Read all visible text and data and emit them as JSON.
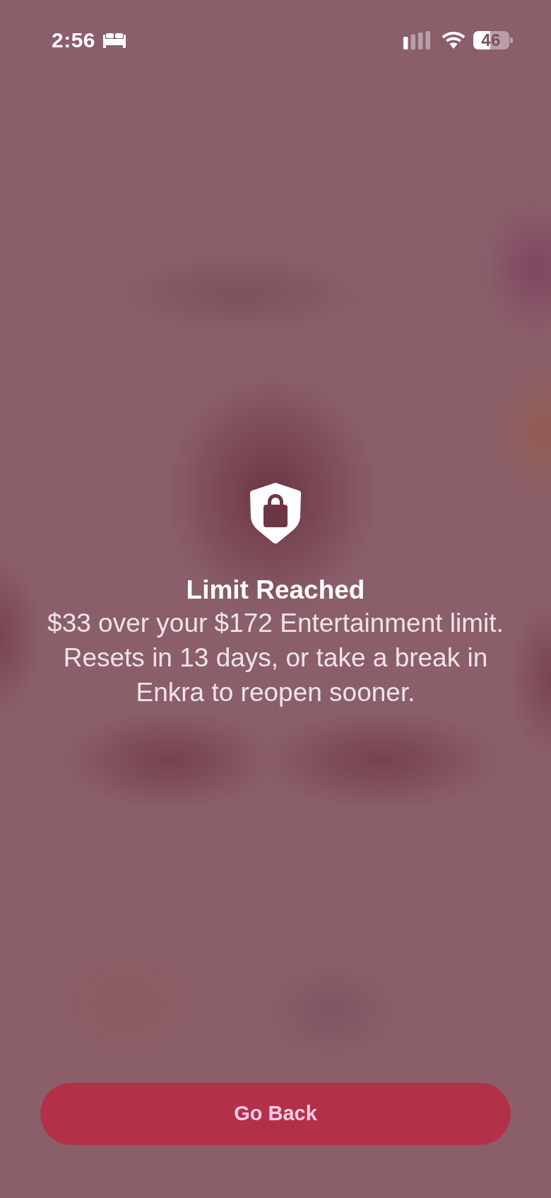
{
  "status_bar": {
    "time": "2:56",
    "battery": "46"
  },
  "alert": {
    "title": "Limit Reached",
    "message": "$33 over your $172 Entertainment limit. Resets in 13 days, or take a break in Enkra to reopen sooner."
  },
  "buttons": [
    {
      "label": "Go Back"
    }
  ]
}
